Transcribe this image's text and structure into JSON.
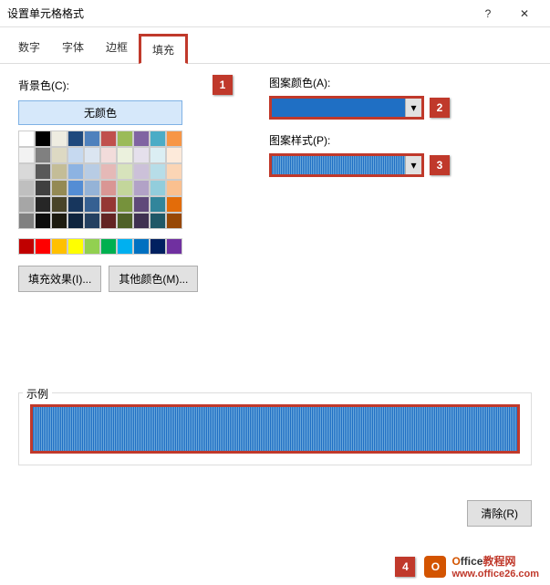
{
  "window": {
    "title": "设置单元格格式"
  },
  "tabs": {
    "t0": "数字",
    "t1": "字体",
    "t2": "边框",
    "t3": "填充"
  },
  "left": {
    "bg_label": "背景色(C):",
    "no_color": "无颜色",
    "fill_effects": "填充效果(I)...",
    "more_colors": "其他颜色(M)..."
  },
  "right": {
    "pattern_color_label": "图案颜色(A):",
    "pattern_style_label": "图案样式(P):"
  },
  "sample": {
    "label": "示例"
  },
  "clear": "清除(R)",
  "callouts": {
    "c1": "1",
    "c2": "2",
    "c3": "3",
    "c4": "4"
  },
  "brand": {
    "p1": "O",
    "p2": "ffice",
    "p3": "教程网",
    "url": "www.office26.com"
  },
  "palette": {
    "row1": [
      "#ffffff",
      "#000000",
      "#eeece1",
      "#1f497d",
      "#4f81bd",
      "#c0504d",
      "#9bbb59",
      "#8064a2",
      "#4bacc6",
      "#f79646"
    ],
    "row2": [
      "#f2f2f2",
      "#808080",
      "#ddd9c3",
      "#c6d9f0",
      "#dbe5f1",
      "#f2dcdb",
      "#ebf1dd",
      "#e5e0ec",
      "#dbeef3",
      "#fdeada"
    ],
    "row3": [
      "#d9d9d9",
      "#595959",
      "#c4bd97",
      "#8db3e2",
      "#b8cce4",
      "#e5b9b7",
      "#d7e3bc",
      "#ccc1d9",
      "#b7dde8",
      "#fbd5b5"
    ],
    "row4": [
      "#bfbfbf",
      "#404040",
      "#948a54",
      "#548dd4",
      "#95b3d7",
      "#d99694",
      "#c3d69b",
      "#b2a2c7",
      "#92cddc",
      "#fac08f"
    ],
    "row5": [
      "#a6a6a6",
      "#262626",
      "#494429",
      "#17365d",
      "#366092",
      "#953734",
      "#76923c",
      "#5f497a",
      "#31859b",
      "#e36c09"
    ],
    "row6": [
      "#808080",
      "#0d0d0d",
      "#1d1b10",
      "#0f243e",
      "#244061",
      "#632423",
      "#4f6128",
      "#3f3151",
      "#205867",
      "#974806"
    ],
    "std": [
      "#c00000",
      "#ff0000",
      "#ffc000",
      "#ffff00",
      "#92d050",
      "#00b050",
      "#00b0f0",
      "#0070c0",
      "#002060",
      "#7030a0"
    ]
  }
}
